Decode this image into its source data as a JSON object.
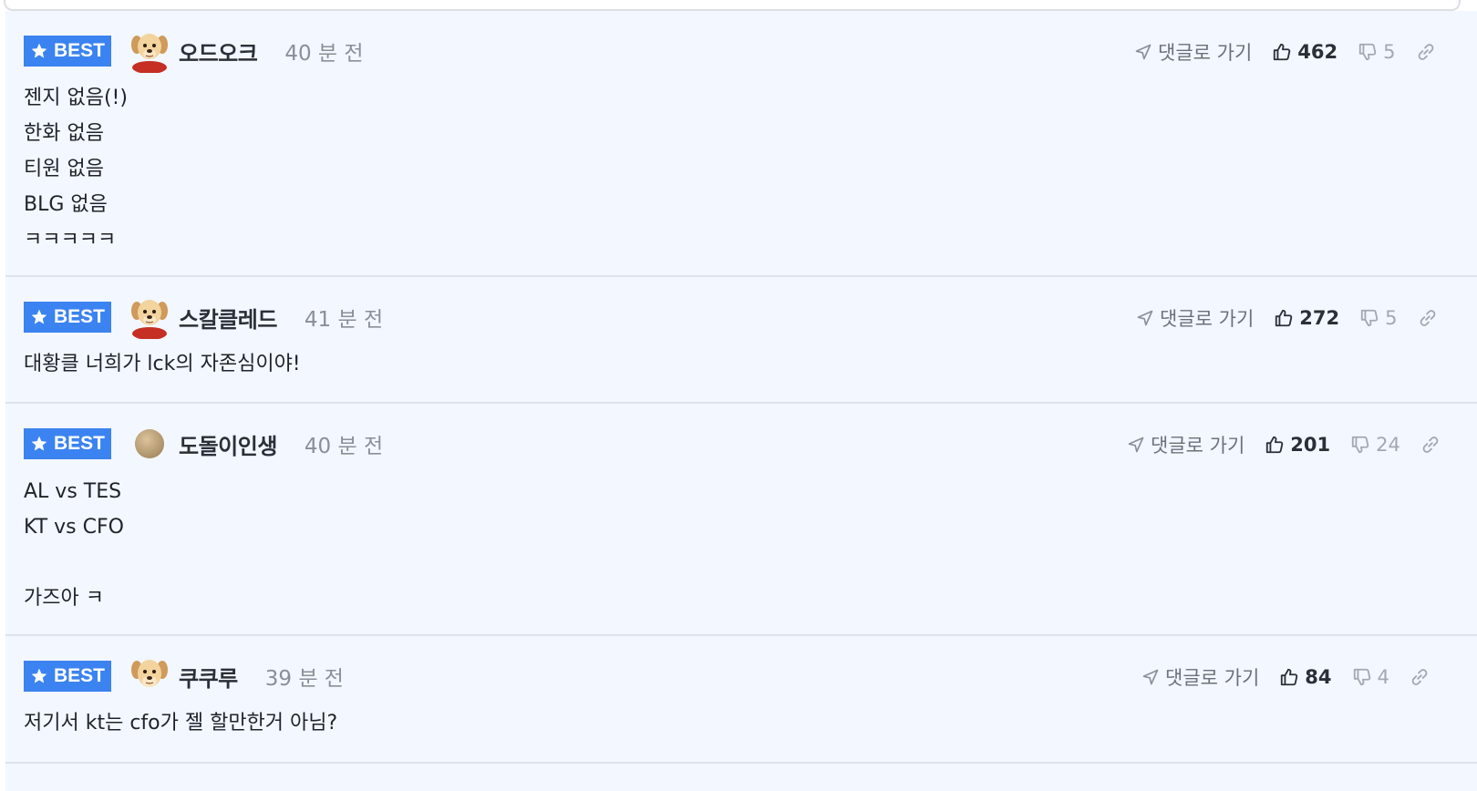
{
  "labels": {
    "badge": "BEST",
    "reply": "댓글로 가기"
  },
  "comments": [
    {
      "author": "오드오크",
      "time": "40 분 전",
      "avatar": "puppy-cape",
      "upvotes": "462",
      "downvotes": "5",
      "text": "젠지 없음(!)\n한화 없음\n티원 없음\nBLG 없음\nㅋㅋㅋㅋㅋ"
    },
    {
      "author": "스칼클레드",
      "time": "41 분 전",
      "avatar": "puppy-cape",
      "upvotes": "272",
      "downvotes": "5",
      "text": "대황클 너희가 lck의 자존심이야!"
    },
    {
      "author": "도돌이인생",
      "time": "40 분 전",
      "avatar": "beige-circle",
      "upvotes": "201",
      "downvotes": "24",
      "text": "AL vs TES\nKT vs CFO\n\n가즈아 ㅋ"
    },
    {
      "author": "쿠쿠루",
      "time": "39 분 전",
      "avatar": "puppy",
      "upvotes": "84",
      "downvotes": "4",
      "text": "저기서 kt는 cfo가 젤 할만한거 아님?"
    }
  ],
  "colors": {
    "badge": "#3b83f0",
    "background": "#f3f7ff",
    "divider": "#dde3ec"
  }
}
